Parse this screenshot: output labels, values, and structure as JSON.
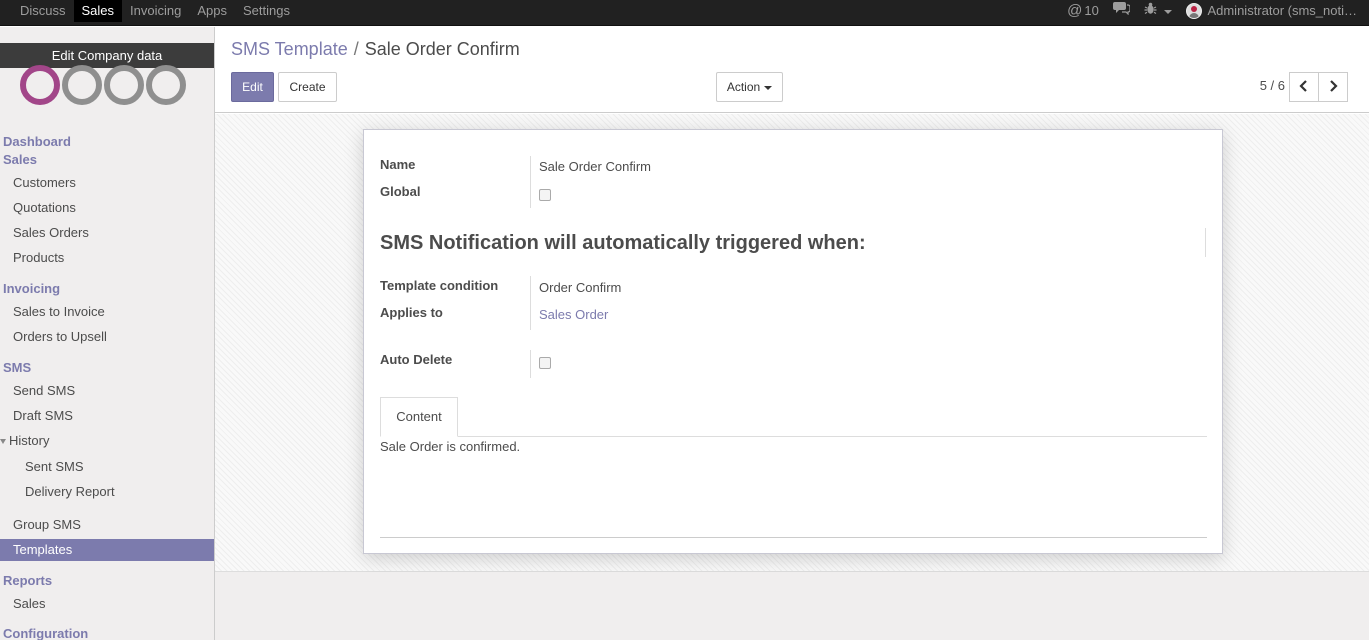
{
  "topbar": {
    "apps": [
      "Discuss",
      "Sales",
      "Invoicing",
      "Apps",
      "Settings"
    ],
    "active_app": "Sales",
    "mention_count": "10",
    "user_label": "Administrator (sms_noti…"
  },
  "sidebar": {
    "edit_company": "Edit Company data",
    "dashboard": "Dashboard",
    "sales_section": "Sales",
    "sales_items": [
      "Customers",
      "Quotations",
      "Sales Orders",
      "Products"
    ],
    "invoicing_section": "Invoicing",
    "invoicing_items": [
      "Sales to Invoice",
      "Orders to Upsell"
    ],
    "sms_section": "SMS",
    "sms_items": [
      "Send SMS",
      "Draft SMS"
    ],
    "history": "History",
    "history_items": [
      "Sent SMS",
      "Delivery Report"
    ],
    "group_sms": "Group SMS",
    "templates": "Templates",
    "reports_section": "Reports",
    "reports_items": [
      "Sales"
    ],
    "configuration_section": "Configuration"
  },
  "control": {
    "breadcrumb_parent": "SMS Template",
    "breadcrumb_sep": "/",
    "breadcrumb_current": "Sale Order Confirm",
    "edit_label": "Edit",
    "create_label": "Create",
    "action_label": "Action",
    "pager": "5 / 6"
  },
  "form": {
    "name_label": "Name",
    "name_value": "Sale Order Confirm",
    "global_label": "Global",
    "global_checked": false,
    "heading": "SMS Notification will automatically triggered when:",
    "condition_label": "Template condition",
    "condition_value": "Order Confirm",
    "applies_label": "Applies to",
    "applies_value": "Sales Order",
    "autodelete_label": "Auto Delete",
    "autodelete_checked": false,
    "tab_content": "Content",
    "content_text": "Sale Order is confirmed."
  },
  "colors": {
    "brand": "#7c7bad",
    "navbar": "#212121",
    "logo_accent": "#a24689"
  }
}
